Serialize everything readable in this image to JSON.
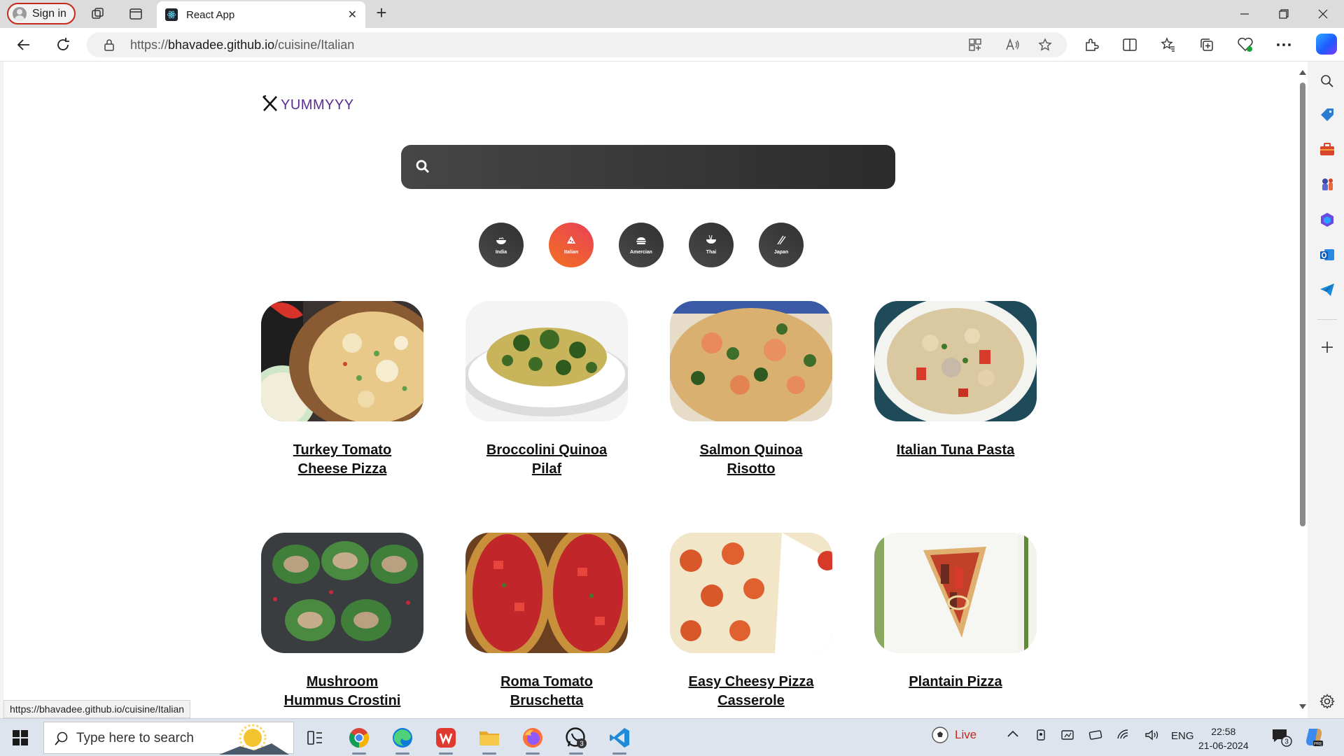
{
  "browser": {
    "signin_label": "Sign in",
    "tab_title": "React App",
    "url_prefix": "https://",
    "url_domain": "bhavadee.github.io",
    "url_path": "/cuisine/Italian",
    "status_url": "https://bhavadee.github.io/cuisine/Italian"
  },
  "page": {
    "logo_text": "YUMMYYY",
    "search_value": "",
    "cuisines": [
      {
        "label": "India",
        "icon": "bowl-icon",
        "active": false
      },
      {
        "label": "Italian",
        "icon": "pizza-icon",
        "active": true
      },
      {
        "label": "Amercian",
        "icon": "burger-icon",
        "active": false
      },
      {
        "label": "Thai",
        "icon": "noodles-icon",
        "active": false
      },
      {
        "label": "Japan",
        "icon": "chopsticks-icon",
        "active": false
      }
    ],
    "recipes": [
      {
        "title": "Turkey Tomato Cheese Pizza"
      },
      {
        "title": "Broccolini Quinoa Pilaf"
      },
      {
        "title": "Salmon Quinoa Risotto"
      },
      {
        "title": "Italian Tuna Pasta"
      },
      {
        "title": "Mushroom Hummus Crostini"
      },
      {
        "title": "Roma Tomato Bruschetta"
      },
      {
        "title": "Easy Cheesy Pizza Casserole"
      },
      {
        "title": "Plantain Pizza"
      }
    ],
    "accent_gradient": [
      "#f27121",
      "#e94057"
    ],
    "logo_color": "#5a2d91"
  },
  "taskbar": {
    "search_placeholder": "Type here to search",
    "live_label": "Live",
    "lang": "ENG",
    "time": "22:58",
    "date": "21-06-2024",
    "whatsapp_badge": "3",
    "notification_badge": "3"
  }
}
